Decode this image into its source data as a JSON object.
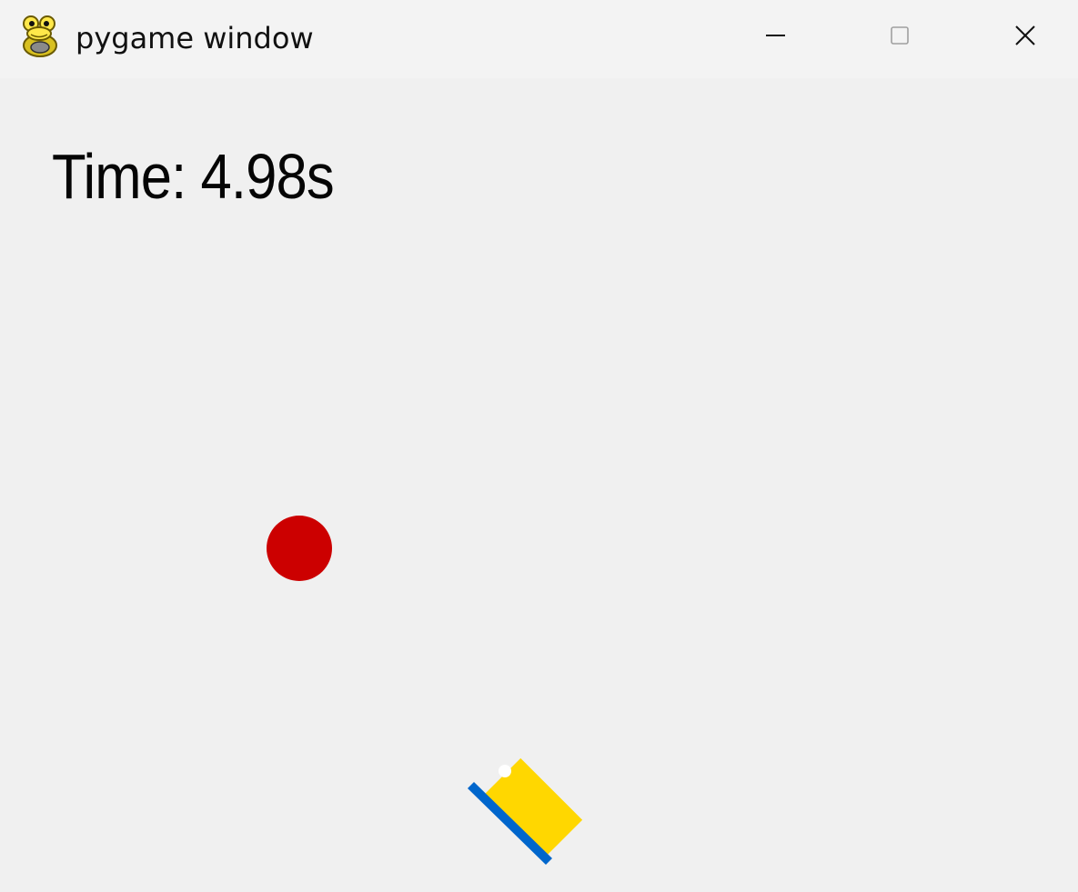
{
  "window": {
    "title": "pygame window",
    "icon": "pygame-snake-icon",
    "controls": {
      "minimize": "minimize-icon",
      "maximize": "maximize-icon",
      "close": "close-icon"
    }
  },
  "game": {
    "timer_text": "Time: 4.98s",
    "colors": {
      "background": "#f0f0f0",
      "ball": "#cc0000",
      "player_body": "#ffd700",
      "player_edge": "#0066cc",
      "player_eye": "#ffffff"
    },
    "entities": {
      "ball": "red-ball",
      "player": "yellow-blue-player"
    }
  }
}
